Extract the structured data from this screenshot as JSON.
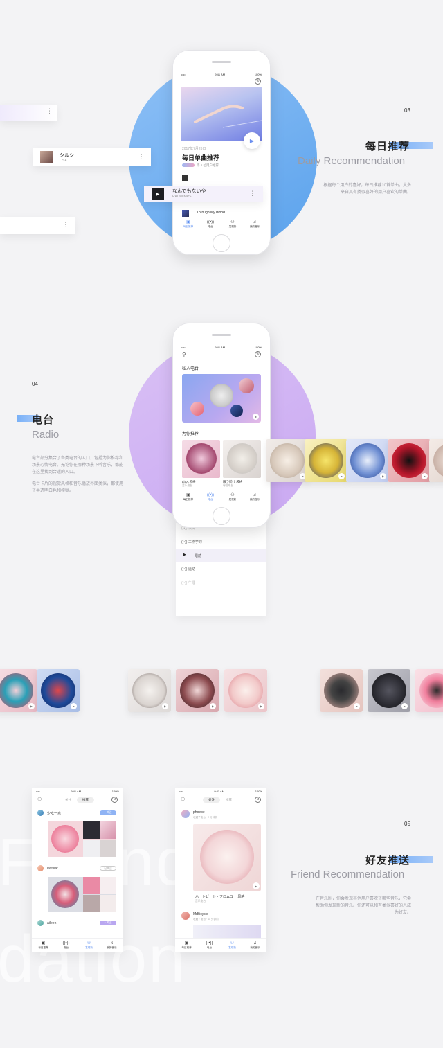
{
  "colors": {
    "accent_blue": "#5a8df0",
    "circle_blue": "#6aaaf0",
    "circle_purple": "#d2b5f4",
    "bg": "#f3f3f5"
  },
  "status": {
    "time": "9:41 AM",
    "battery": "100%"
  },
  "tabs": [
    "每日推荐",
    "电台",
    "发现新",
    "我的音乐"
  ],
  "tab_icons": [
    "calendar-icon",
    "radio-icon",
    "add-friend-icon",
    "music-note-icon"
  ],
  "section_daily": {
    "number": "03",
    "title": "每日推荐",
    "subtitle": "Daily Recommendation",
    "description": "根据每个用户的喜好，每日推荐10首单曲，大多来自具有类似喜好的用户喜欢的单曲。"
  },
  "daily_screen": {
    "date": "2017年7月26日",
    "title": "每日单曲推荐",
    "meta": "等 6 位用户推荐",
    "track_last": "Through My Blood"
  },
  "floating_tracks": [
    {
      "title": "シルシ",
      "artist": "LiSA"
    },
    {
      "title": "なんでもないや",
      "artist": "RADWIMPS"
    }
  ],
  "section_radio": {
    "number": "04",
    "title": "电台",
    "subtitle": "Radio",
    "description1": "电台部分集合了各类电台的入口，包括为你推荐和场景心情电台。无论你在哪种场景下听音乐，都能在这里找到合适的入口。",
    "description2": "电台卡片的视觉风格和音乐播放界面类似，都使用了半透明白色和模糊。"
  },
  "radio_screen": {
    "private_fm": "私人电台",
    "for_you": "为你推荐",
    "cards": [
      {
        "title": "LiSA 风格",
        "sub": "音乐电台"
      },
      {
        "title": "眼ラ続け 风格",
        "sub": "粤语电台"
      }
    ]
  },
  "radio_list": [
    "工作学习",
    "睡前",
    "运动",
    "午睡"
  ],
  "radio_list_top": "读英",
  "section_friend": {
    "number": "05",
    "title": "好友推送",
    "subtitle": "Friend Recommendation",
    "description": "在音乐圈，你会发现其他用户喜欢了哪些音乐，它会帮助你发现新的音乐。你还可以和有类似喜好的人成为好友。"
  },
  "friend_left": {
    "seg": [
      "关注",
      "推荐"
    ],
    "users": [
      {
        "name": "少吃一点",
        "btn": "+ 关注"
      },
      {
        "name": "lastslar",
        "btn": "已关注"
      },
      {
        "name": "aileen",
        "btn": "+ 关注"
      }
    ]
  },
  "friend_right": {
    "seg": [
      "关注",
      "推荐"
    ],
    "user1": "phoebe",
    "user1_meta": "收藏了电台 · 2 分钟前",
    "card_title": "ハートビート・フロムユー 风格",
    "card_sub": "音乐电台",
    "user2": "MrBicycle",
    "user2_meta": "收藏了电台 · 11 分钟前"
  },
  "big_text": {
    "line1": "Friend",
    "line2": "dation"
  }
}
